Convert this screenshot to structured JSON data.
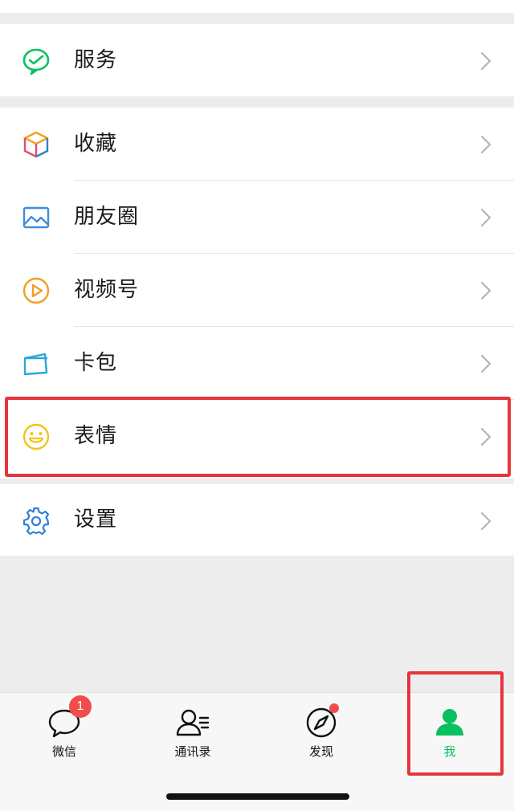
{
  "menu": {
    "service": {
      "label": "服务",
      "icon": "service-icon"
    },
    "items": [
      {
        "label": "收藏",
        "icon": "favorites-cube-icon"
      },
      {
        "label": "朋友圈",
        "icon": "moments-picture-icon"
      },
      {
        "label": "视频号",
        "icon": "channels-play-icon"
      },
      {
        "label": "卡包",
        "icon": "card-wallet-icon"
      },
      {
        "label": "表情",
        "icon": "sticker-smile-icon"
      }
    ],
    "settings": {
      "label": "设置",
      "icon": "settings-gear-icon"
    }
  },
  "tabbar": {
    "tabs": [
      {
        "label": "微信",
        "icon": "chats-bubble-icon",
        "badge": "1"
      },
      {
        "label": "通讯录",
        "icon": "contacts-icon"
      },
      {
        "label": "发现",
        "icon": "discover-compass-icon",
        "dot": true
      },
      {
        "label": "我",
        "icon": "me-person-icon",
        "active": true
      }
    ]
  },
  "colors": {
    "accent": "#07c160",
    "highlight": "#e8343b",
    "badge": "#f24c4c",
    "background": "#ededed"
  }
}
